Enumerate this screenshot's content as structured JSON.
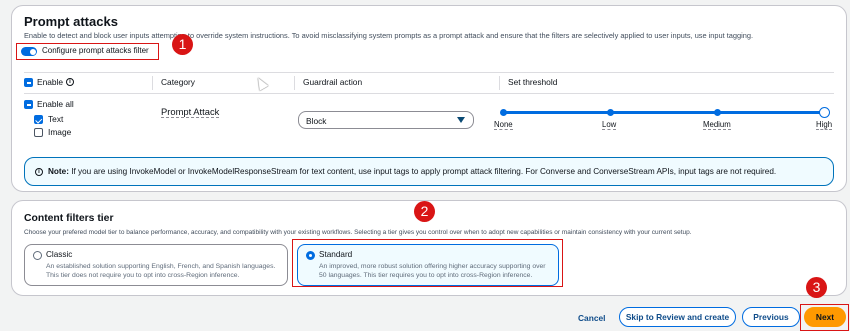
{
  "prompt_attacks": {
    "title": "Prompt attacks",
    "description": "Enable to detect and block user inputs attempting to override system instructions. To avoid misclassifying system prompts as a prompt attack and ensure that the filters are selectively applied to user inputs, use input tagging.",
    "toggle_label": "Configure prompt attacks filter",
    "toggle_on": true,
    "columns": {
      "enable": "Enable",
      "category": "Category",
      "action": "Guardrail action",
      "threshold": "Set threshold"
    },
    "enable_all": "Enable all",
    "modalities": [
      {
        "label": "Text",
        "checked": true
      },
      {
        "label": "Image",
        "checked": false
      }
    ],
    "category": "Prompt Attack",
    "action_value": "Block",
    "threshold_levels": [
      "None",
      "Low",
      "Medium",
      "High"
    ],
    "threshold_selected": "High",
    "note_label": "Note:",
    "note_text": "If you are using InvokeModel or InvokeModelResponseStream for text content, use input tags to apply prompt attack filtering. For Converse and ConverseStream APIs, input tags are not required."
  },
  "content_filters_tier": {
    "title": "Content filters tier",
    "description": "Choose your prefered model tier to balance performance, accuracy, and compatibility with your existing workflows. Selecting a tier gives you control over when to adopt new capabilities or maintain consistency with your current setup.",
    "options": [
      {
        "title": "Classic",
        "description": "An established solution supporting English, French, and Spanish languages. This tier does not require you to opt into cross-Region inference.",
        "selected": false
      },
      {
        "title": "Standard",
        "description": "An improved, more robust solution offering higher accuracy supporting over 50 languages. This tier requires you to opt into cross-Region inference.",
        "selected": true
      }
    ]
  },
  "footer": {
    "cancel": "Cancel",
    "skip": "Skip to Review and create",
    "previous": "Previous",
    "next": "Next"
  },
  "annotations": [
    "1",
    "2",
    "3"
  ],
  "colors": {
    "accent": "#006ce0",
    "annotation": "#d91515",
    "primary_button": "#ff9900"
  }
}
